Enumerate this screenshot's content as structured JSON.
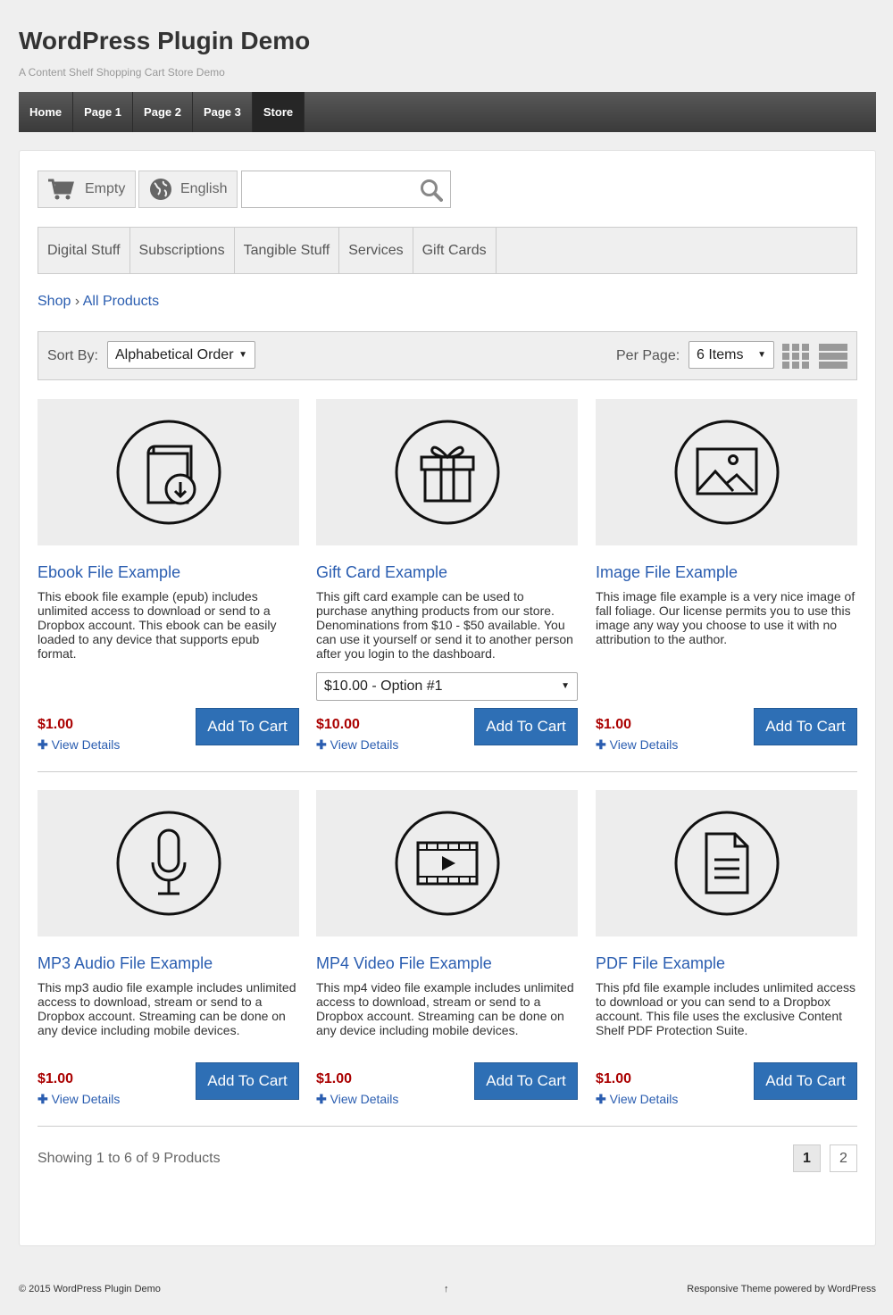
{
  "site": {
    "title": "WordPress Plugin Demo",
    "description": "A Content Shelf Shopping Cart Store Demo"
  },
  "nav": [
    "Home",
    "Page 1",
    "Page 2",
    "Page 3",
    "Store"
  ],
  "toolbar": {
    "cart_label": "Empty",
    "language_label": "English",
    "search_placeholder": ""
  },
  "categories": [
    "Digital Stuff",
    "Subscriptions",
    "Tangible Stuff",
    "Services",
    "Gift Cards"
  ],
  "breadcrumb": {
    "shop": "Shop",
    "separator": "›",
    "current": "All Products"
  },
  "sort": {
    "sort_label": "Sort By:",
    "sort_value": "Alphabetical Order",
    "per_page_label": "Per Page:",
    "per_page_value": "6 Items"
  },
  "products": [
    {
      "title": "Ebook File Example",
      "icon": "ebook-icon",
      "description": "This ebook file example (epub) includes unlimited access to download or send to a Dropbox account. This ebook can be easily loaded to any device that supports epub format.",
      "price": "$1.00",
      "details": "View Details",
      "button": "Add To Cart"
    },
    {
      "title": "Gift Card Example",
      "icon": "gift-icon",
      "description": "This gift card example can be used to purchase anything products from our store. Denominations from $10 - $50 available. You can use it yourself or send it to another person after you login to the dashboard.",
      "option": "$10.00 - Option #1",
      "price": "$10.00",
      "details": "View Details",
      "button": "Add To Cart"
    },
    {
      "title": "Image File Example",
      "icon": "image-icon",
      "description": "This image file example is a very nice image of fall foliage. Our license permits you to use this image any way you choose to use it with no attribution to the author.",
      "price": "$1.00",
      "details": "View Details",
      "button": "Add To Cart"
    },
    {
      "title": "MP3 Audio File Example",
      "icon": "microphone-icon",
      "description": "This mp3 audio file example includes unlimited access to download, stream or send to a Dropbox account. Streaming can be done on any device including mobile devices.",
      "price": "$1.00",
      "details": "View Details",
      "button": "Add To Cart"
    },
    {
      "title": "MP4 Video File Example",
      "icon": "video-icon",
      "description": "This mp4 video file example includes unlimited access to download, stream or send to a Dropbox account. Streaming can be done on any device including mobile devices.",
      "price": "$1.00",
      "details": "View Details",
      "button": "Add To Cart"
    },
    {
      "title": "PDF File Example",
      "icon": "document-icon",
      "description": "This pfd file example includes unlimited access to download or you can send to a Dropbox account. This file uses the exclusive Content Shelf PDF Protection Suite.",
      "price": "$1.00",
      "details": "View Details",
      "button": "Add To Cart"
    }
  ],
  "pagination": {
    "showing": "Showing 1 to 6 of 9 Products",
    "pages": [
      "1",
      "2"
    ]
  },
  "footer": {
    "copyright": "© 2015 WordPress Plugin Demo",
    "top_arrow": "↑",
    "credit": "Responsive Theme powered by WordPress"
  },
  "colors": {
    "link": "#2a5db0",
    "price": "#aa0000",
    "button": "#2e6fb5",
    "nav": "#3a3a3a"
  }
}
